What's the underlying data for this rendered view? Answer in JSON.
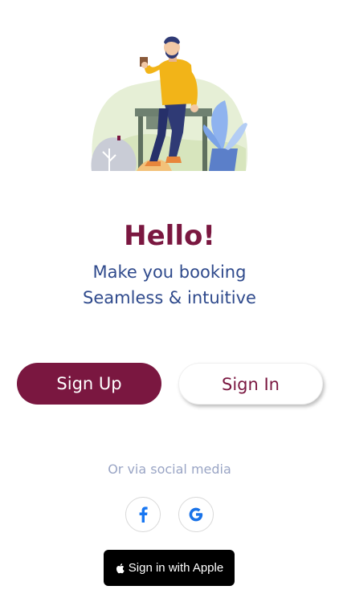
{
  "hero": {
    "title": "Hello!",
    "subtitle_line1": "Make you booking",
    "subtitle_line2": "Seamless & intuitive"
  },
  "actions": {
    "signup_label": "Sign Up",
    "signin_label": "Sign In"
  },
  "social": {
    "label": "Or via social media",
    "icons": [
      "facebook-icon",
      "google-icon"
    ]
  },
  "apple": {
    "label": "Sign in with Apple"
  },
  "colors": {
    "primary": "#7a1740",
    "subtitle": "#2f4a8c",
    "muted": "#9aa5c5",
    "facebook": "#1877f2"
  }
}
